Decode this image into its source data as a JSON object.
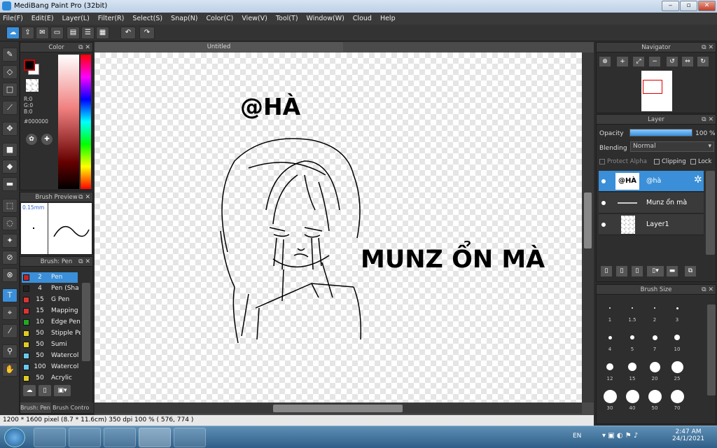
{
  "window": {
    "title": "MediBang Paint Pro (32bit)",
    "min": "‒",
    "max": "▫",
    "close": "✕"
  },
  "menu": [
    "File(F)",
    "Edit(E)",
    "Layer(L)",
    "Filter(R)",
    "Select(S)",
    "Snap(N)",
    "Color(C)",
    "View(V)",
    "Tool(T)",
    "Window(W)",
    "Cloud",
    "Help"
  ],
  "color_panel": {
    "title": "Color",
    "r": "R:0",
    "g": "G:0",
    "b": "B:0",
    "hex": "#000000"
  },
  "brush_preview": {
    "title": "Brush Preview",
    "size": "0.15mm"
  },
  "brush_panel": {
    "title": "Brush: Pen",
    "items": [
      {
        "size": "2",
        "name": "Pen",
        "color": "#cc2222"
      },
      {
        "size": "4",
        "name": "Pen (Sha",
        "color": "#222222"
      },
      {
        "size": "15",
        "name": "G Pen",
        "color": "#dd3333"
      },
      {
        "size": "15",
        "name": "Mapping I",
        "color": "#dd3333"
      },
      {
        "size": "10",
        "name": "Edge Pen",
        "color": "#22aa22"
      },
      {
        "size": "50",
        "name": "Stipple Pe",
        "color": "#ddcc22"
      },
      {
        "size": "50",
        "name": "Sumi",
        "color": "#ddcc22"
      },
      {
        "size": "50",
        "name": "Watercol",
        "color": "#66ccee"
      },
      {
        "size": "100",
        "name": "Watercol",
        "color": "#66ccee"
      },
      {
        "size": "50",
        "name": "Acrylic",
        "color": "#ddcc22"
      }
    ],
    "tab1": "Brush: Pen",
    "tab2": "Brush Contro"
  },
  "document": {
    "tab": "Untitled",
    "text1": "@HÀ",
    "text2": "MUNZ ỔN MÀ"
  },
  "navigator": {
    "title": "Navigator"
  },
  "layer_panel": {
    "title": "Layer",
    "opacity_label": "Opacity",
    "opacity_value": "100 %",
    "opacity_fraction": 1.0,
    "blending_label": "Blending",
    "blending_value": "Normal",
    "protect_alpha": "Protect Alpha",
    "clipping": "Clipping",
    "lock": "Lock",
    "layers": [
      {
        "name": "@hà",
        "thumb": "@HÀ"
      },
      {
        "name": "Munz ổn mà",
        "thumb": ""
      },
      {
        "name": "Layer1",
        "thumb": ""
      }
    ]
  },
  "brush_size": {
    "title": "Brush Size",
    "sizes": [
      "1",
      "1.5",
      "2",
      "3",
      "4",
      "5",
      "7",
      "10",
      "12",
      "15",
      "20",
      "25",
      "30",
      "40",
      "50",
      "70"
    ]
  },
  "status": {
    "text": "1200 * 1600 pixel   (8.7 * 11.6cm)   350 dpi   100 %   ( 576, 774 )"
  },
  "taskbar": {
    "lang": "EN",
    "time": "2:47 AM",
    "date": "24/1/2021"
  }
}
